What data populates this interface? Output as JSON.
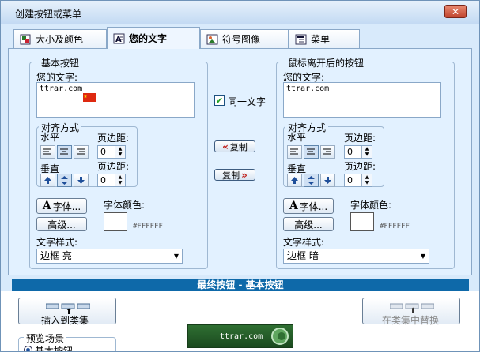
{
  "window": {
    "title": "创建按钮或菜单",
    "close_label": "✕"
  },
  "tabs": [
    {
      "label": "大小及颜色",
      "icon": "size-color-icon"
    },
    {
      "label": "您的文字",
      "icon": "text-icon",
      "active": true
    },
    {
      "label": "符号图像",
      "icon": "symbol-image-icon"
    },
    {
      "label": "菜单",
      "icon": "menu-icon"
    }
  ],
  "basic": {
    "legend": "基本按钮",
    "text_label": "您的文字:",
    "text_value": "ttrar.com",
    "align_legend": "对齐方式",
    "horizontal_label": "水平",
    "vertical_label": "垂直",
    "h_margin_label": "页边距:",
    "h_margin_value": "0",
    "v_margin_label": "页边距:",
    "v_margin_value": "0",
    "font_button": "字体...",
    "advanced_button": "高级...",
    "font_color_label": "字体颜色:",
    "color_hex": "#FFFFFF",
    "text_style_label": "文字样式:",
    "text_style_value": "边框 亮"
  },
  "hover": {
    "legend": "鼠标离开后的按钮",
    "text_label": "您的文字:",
    "text_value": "ttrar.com",
    "align_legend": "对齐方式",
    "horizontal_label": "水平",
    "vertical_label": "垂直",
    "h_margin_label": "页边距:",
    "h_margin_value": "0",
    "v_margin_label": "页边距:",
    "v_margin_value": "0",
    "font_button": "字体...",
    "advanced_button": "高级...",
    "font_color_label": "字体颜色:",
    "color_hex": "#FFFFFF",
    "text_style_label": "文字样式:",
    "text_style_value": "边框 暗"
  },
  "middle": {
    "same_text_label": "同一文字",
    "same_text_checked": true,
    "copy_left_label": "复制",
    "copy_right_label": "复制"
  },
  "final": {
    "title": "最终按钮 - 基本按钮",
    "insert_label": "插入到类集",
    "replace_label": "在类集中替换",
    "scene_legend": "预览场景",
    "scene_option": "基本按钮",
    "preview_text": "ttrar.com"
  },
  "colors": {
    "accent": "#0e69a9",
    "panel": "#e2f1ff",
    "preview_bg": "#2f6f32"
  }
}
